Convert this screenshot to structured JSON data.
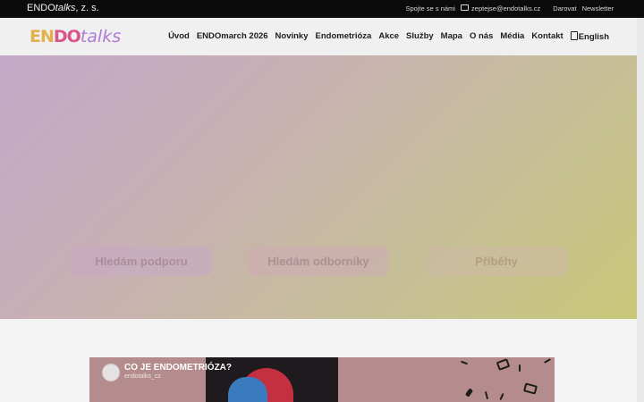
{
  "topbar": {
    "org_prefix": "ENDO",
    "org_italic": "talks",
    "org_suffix": ", z. s.",
    "contact_label": "Spojte se s námi",
    "email": "zeptejse@endotalks.cz",
    "donate": "Darovat",
    "newsletter": "Newsletter"
  },
  "logo": {
    "part1": "EN",
    "part2": "DO",
    "part3": "talks"
  },
  "menu": {
    "items": [
      "Úvod",
      "ENDOmarch 2026",
      "Novinky",
      "Endometrióza",
      "Akce",
      "Služby",
      "Mapa",
      "O nás",
      "Média",
      "Kontakt"
    ],
    "language": "English"
  },
  "hero": {
    "buttons": [
      "Hledám podporu",
      "Hledám odborníky",
      "Příběhy"
    ]
  },
  "video": {
    "title": "CO JE ENDOMETRIÓZA?",
    "channel": "endotalks_cz"
  }
}
